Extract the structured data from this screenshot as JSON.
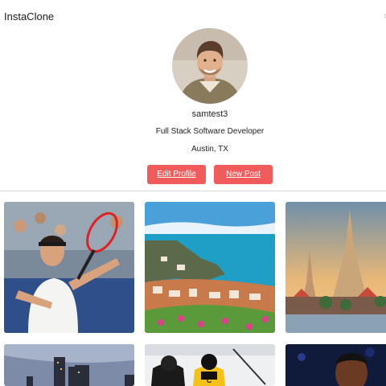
{
  "header": {
    "app_title": "InstaClone"
  },
  "profile": {
    "username": "samtest3",
    "bio": "Full Stack Software Developer",
    "location": "Austin, TX",
    "avatar_icon": "user-portrait"
  },
  "actions": {
    "edit_profile_label": "Edit Profile",
    "new_post_label": "New Post",
    "button_color": "#f25b5b"
  },
  "posts": [
    {
      "subject": "tennis-player-photo"
    },
    {
      "subject": "coastal-village-photo"
    },
    {
      "subject": "temple-spire-photo"
    },
    {
      "subject": "city-skyline-photo"
    },
    {
      "subject": "hockey-players-photo"
    },
    {
      "subject": "basketball-player-photo"
    }
  ]
}
